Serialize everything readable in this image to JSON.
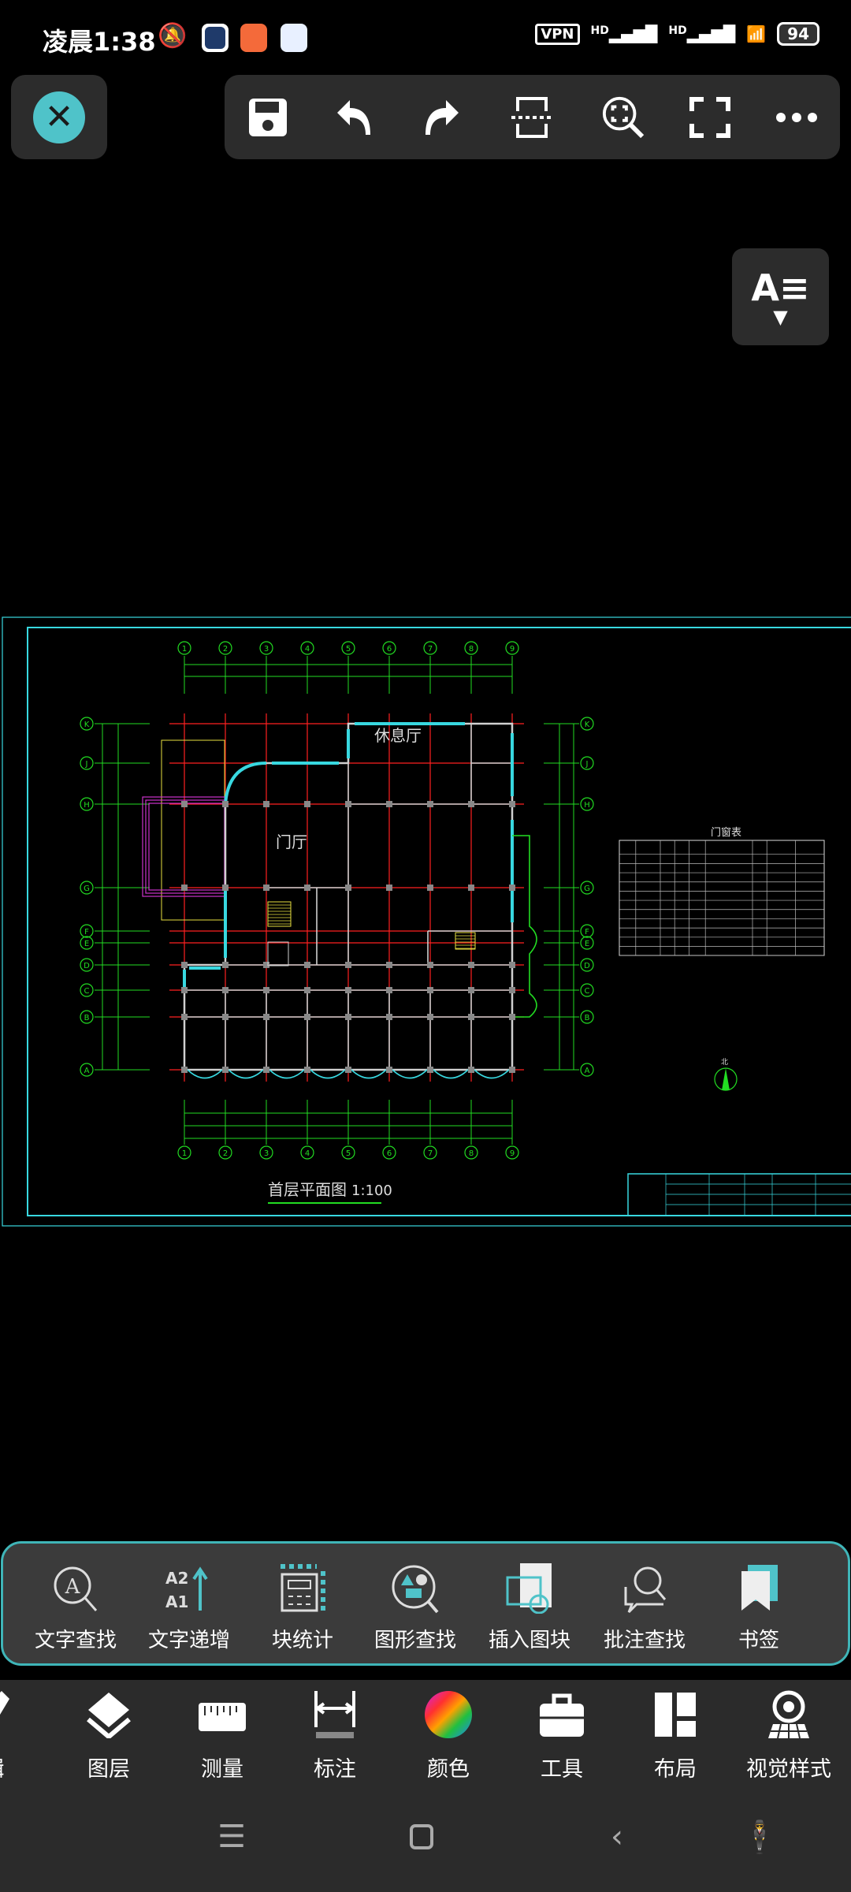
{
  "status_bar": {
    "time": "凌晨1:38",
    "vpn": "VPN",
    "signal1": "HD",
    "signal2": "HD",
    "battery": "94"
  },
  "top_toolbar": {
    "close": "close-icon",
    "buttons": [
      "save-icon",
      "undo-icon",
      "redo-icon",
      "split-view-icon",
      "zoom-extents-icon",
      "fullscreen-icon",
      "more-icon"
    ]
  },
  "text_style_button": {
    "label": "A≡"
  },
  "drawing": {
    "title": "首层平面图",
    "scale": "1:100",
    "column_axes": [
      "1",
      "2",
      "3",
      "4",
      "5",
      "6",
      "7",
      "8",
      "9"
    ],
    "row_axes": [
      "K",
      "J",
      "H",
      "G",
      "F",
      "E",
      "D",
      "C",
      "B",
      "A"
    ],
    "rooms": [
      "休息厅",
      "门厅"
    ],
    "door_window_table_title": "门窗表",
    "north_label": "北",
    "colors": {
      "grid": "#ff2020",
      "axis": "#22dd22",
      "window": "#38d8e0",
      "wall": "#d0d0d0",
      "frame": "#38d8e0",
      "entrance": "#cc33cc",
      "stair": "#e8e040"
    }
  },
  "tool_panel": {
    "items": [
      {
        "label": "文字查找",
        "icon": "text-search-icon"
      },
      {
        "label": "文字递增",
        "icon": "text-increment-icon"
      },
      {
        "label": "块统计",
        "icon": "block-count-icon"
      },
      {
        "label": "图形查找",
        "icon": "shape-search-icon"
      },
      {
        "label": "插入图块",
        "icon": "insert-block-icon"
      },
      {
        "label": "批注查找",
        "icon": "annotation-search-icon"
      },
      {
        "label": "书签",
        "icon": "bookmark-icon"
      }
    ]
  },
  "bottom_bar": {
    "items": [
      {
        "label": "辑",
        "icon": "edit-icon"
      },
      {
        "label": "图层",
        "icon": "layers-icon"
      },
      {
        "label": "测量",
        "icon": "ruler-icon"
      },
      {
        "label": "标注",
        "icon": "dimension-icon"
      },
      {
        "label": "颜色",
        "icon": "color-wheel-icon"
      },
      {
        "label": "工具",
        "icon": "toolbox-icon"
      },
      {
        "label": "布局",
        "icon": "layout-icon"
      },
      {
        "label": "视觉样式",
        "icon": "visual-style-icon"
      }
    ]
  },
  "nav_bar": [
    "menu-icon",
    "home-icon",
    "back-icon",
    "accessibility-icon"
  ]
}
